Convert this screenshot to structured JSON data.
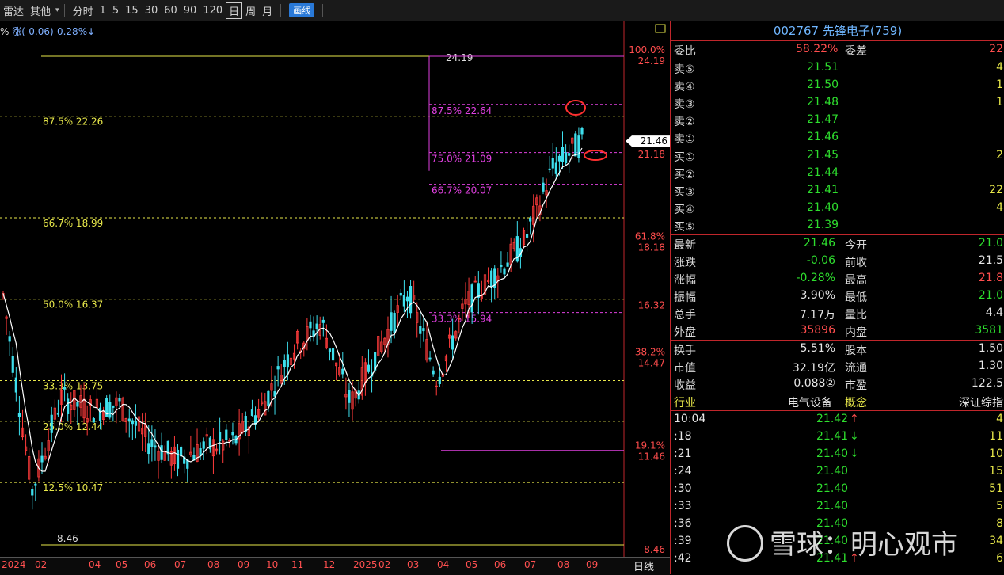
{
  "toolbar": {
    "items": [
      "雷达",
      "其他",
      "分时",
      "1",
      "5",
      "15",
      "30",
      "60",
      "90",
      "120",
      "日",
      "周",
      "月"
    ],
    "active": "日",
    "indicator_button": "画线"
  },
  "legend": {
    "prefix": "%",
    "text": "涨(-0.06)-0.28%",
    "arrow": "↓"
  },
  "colors": {
    "up": "#ff3b3b",
    "down": "#3ee0ee",
    "ma": "#ffffff",
    "fib_yellow": "#e8e84a",
    "fib_magenta": "#e040e0",
    "panel_border": "#c0262b"
  },
  "fib_left": [
    {
      "label": "87.5% 22.26",
      "price": 22.26
    },
    {
      "label": "66.7% 18.99",
      "price": 18.99
    },
    {
      "label": "50.0% 16.37",
      "price": 16.37
    },
    {
      "label": "33.3% 13.75",
      "price": 13.75
    },
    {
      "label": "25.0% 12.44",
      "price": 12.44
    },
    {
      "label": "12.5% 10.47",
      "price": 10.47
    }
  ],
  "fib_top": {
    "label": "24.19",
    "price": 24.19
  },
  "fib_bottom": {
    "label": "8.46",
    "price": 8.46
  },
  "fib_right": [
    {
      "label": "87.5% 22.64",
      "price": 22.64
    },
    {
      "label": "75.0% 21.09",
      "price": 21.09
    },
    {
      "label": "66.7% 20.07",
      "price": 20.07
    },
    {
      "label": "33.3% 15.94",
      "price": 15.94
    }
  ],
  "price_axis": [
    {
      "pct": "100.0%",
      "price": "24.19"
    },
    {
      "pct": "",
      "price": "21.18"
    },
    {
      "pct": "61.8%",
      "price": "18.18"
    },
    {
      "pct": "",
      "price": "16.32"
    },
    {
      "pct": "38.2%",
      "price": "14.47"
    },
    {
      "pct": "19.1%",
      "price": "11.46"
    },
    {
      "pct": "",
      "price": "8.46"
    }
  ],
  "current_price_tag": "21.46",
  "x_axis": [
    "2024",
    "02",
    "04",
    "05",
    "06",
    "07",
    "08",
    "09",
    "10",
    "11",
    "12",
    "2025",
    "02",
    "03",
    "04",
    "05",
    "06",
    "07",
    "08",
    "09"
  ],
  "period_label": "日线",
  "stock": {
    "title": "002767 先锋电子(759)",
    "weibi_label": "委比",
    "weibi_value": "58.22%",
    "weicha_label": "委差",
    "weicha_value": "22",
    "sells": [
      {
        "label": "卖⑤",
        "price": "21.51",
        "vol": "4"
      },
      {
        "label": "卖④",
        "price": "21.50",
        "vol": "1"
      },
      {
        "label": "卖③",
        "price": "21.48",
        "vol": "1"
      },
      {
        "label": "卖②",
        "price": "21.47",
        "vol": ""
      },
      {
        "label": "卖①",
        "price": "21.46",
        "vol": ""
      }
    ],
    "buys": [
      {
        "label": "买①",
        "price": "21.45",
        "vol": "2"
      },
      {
        "label": "买②",
        "price": "21.44",
        "vol": ""
      },
      {
        "label": "买③",
        "price": "21.41",
        "vol": "22"
      },
      {
        "label": "买④",
        "price": "21.40",
        "vol": "4"
      },
      {
        "label": "买⑤",
        "price": "21.39",
        "vol": ""
      }
    ],
    "quote": [
      {
        "l1": "最新",
        "v1": "21.46",
        "c1": "dn",
        "l2": "今开",
        "v2": "21.0",
        "c2": "dn"
      },
      {
        "l1": "涨跌",
        "v1": "-0.06",
        "c1": "dn",
        "l2": "前收",
        "v2": "21.5",
        "c2": "wh"
      },
      {
        "l1": "涨幅",
        "v1": "-0.28%",
        "c1": "dn",
        "l2": "最高",
        "v2": "21.8",
        "c2": "up"
      },
      {
        "l1": "振幅",
        "v1": "3.90%",
        "c1": "wh",
        "l2": "最低",
        "v2": "21.0",
        "c2": "dn"
      },
      {
        "l1": "总手",
        "v1": "7.17万",
        "c1": "wh",
        "l2": "量比",
        "v2": "4.4",
        "c2": "wh"
      },
      {
        "l1": "外盘",
        "v1": "35896",
        "c1": "up",
        "l2": "内盘",
        "v2": "3581",
        "c2": "dn"
      }
    ],
    "info": [
      {
        "l1": "换手",
        "v1": "5.51%",
        "l2": "股本",
        "v2": "1.50"
      },
      {
        "l1": "市值",
        "v1": "32.19亿",
        "l2": "流通",
        "v2": "1.30"
      },
      {
        "l1": "收益",
        "v1": "0.088②",
        "l2": "市盈",
        "v2": "122.5"
      }
    ],
    "industry_label": "行业",
    "industry_value": "电气设备",
    "concept_label": "概念",
    "concept_value": "深证综指",
    "ticks": [
      {
        "time": "10:04",
        "price": "21.42",
        "arrow": "↑",
        "vol": "4"
      },
      {
        "time": ":18",
        "price": "21.41",
        "arrow": "↓",
        "vol": "11"
      },
      {
        "time": ":21",
        "price": "21.40",
        "arrow": "↓",
        "vol": "10"
      },
      {
        "time": ":24",
        "price": "21.40",
        "arrow": "",
        "vol": "15"
      },
      {
        "time": ":30",
        "price": "21.40",
        "arrow": "",
        "vol": "51"
      },
      {
        "time": ":33",
        "price": "21.40",
        "arrow": "",
        "vol": "5"
      },
      {
        "time": ":36",
        "price": "21.40",
        "arrow": "",
        "vol": "8"
      },
      {
        "time": ":39",
        "price": "21.40",
        "arrow": "",
        "vol": "34"
      },
      {
        "time": ":42",
        "price": "21.41",
        "arrow": "↑",
        "vol": "6"
      }
    ]
  },
  "watermark": "雪球：明心观市",
  "chart_data": {
    "type": "line",
    "x": [
      "2024-01",
      "2024-02",
      "2024-03",
      "2024-04",
      "2024-05",
      "2024-06",
      "2024-07",
      "2024-08",
      "2024-09",
      "2024-10",
      "2024-11",
      "2024-12",
      "2025-01",
      "2025-02",
      "2025-03",
      "2025-04",
      "2025-05",
      "2025-06",
      "2025-07",
      "2025-08",
      "2025-09"
    ],
    "values": [
      16.5,
      10.2,
      13.2,
      12.8,
      13.0,
      11.8,
      11.2,
      11.6,
      11.8,
      13.0,
      14.8,
      15.6,
      13.0,
      14.8,
      16.6,
      13.8,
      16.2,
      17.2,
      18.2,
      20.6,
      21.46
    ],
    "ylim": [
      8.46,
      24.19
    ]
  }
}
